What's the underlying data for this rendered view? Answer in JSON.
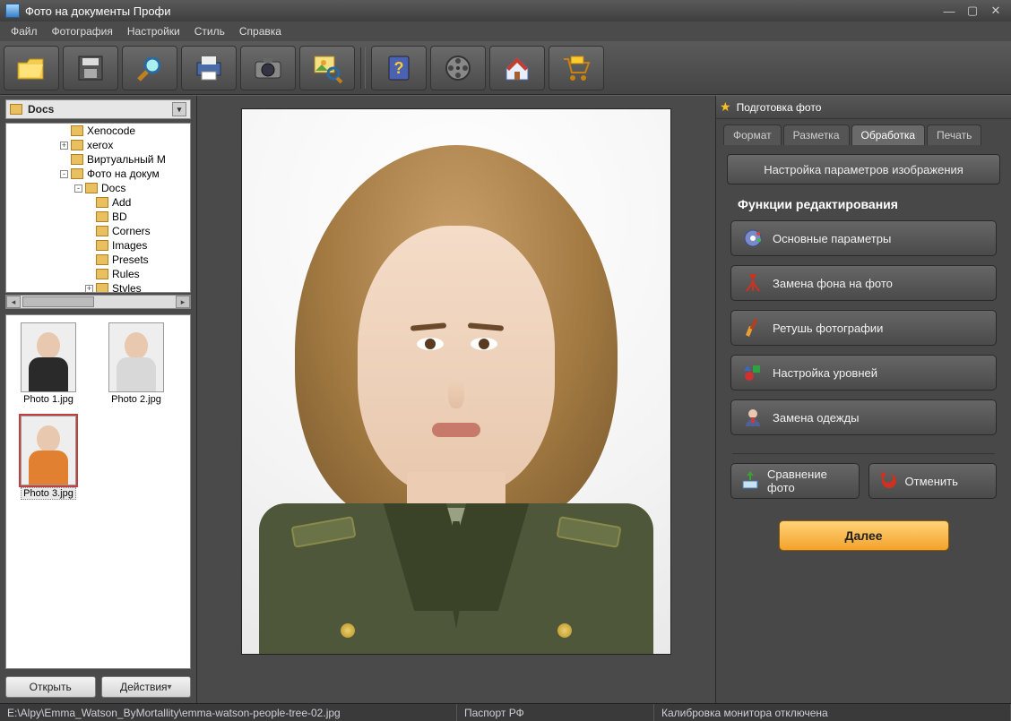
{
  "title": "Фото на документы Профи",
  "menubar": [
    "Файл",
    "Фотография",
    "Настройки",
    "Стиль",
    "Справка"
  ],
  "toolbar_icons": [
    "open-folder-icon",
    "save-icon",
    "search-magnifier-icon",
    "print-icon",
    "camera-icon",
    "image-magnifier-icon",
    "help-book-icon",
    "film-reel-icon",
    "home-icon",
    "shopping-cart-icon"
  ],
  "path_select": "Docs",
  "tree": [
    {
      "pad": 68,
      "exp": "",
      "label": "Xenocode"
    },
    {
      "pad": 56,
      "exp": "+",
      "label": "xerox"
    },
    {
      "pad": 68,
      "exp": "",
      "label": "Виртуальный М"
    },
    {
      "pad": 56,
      "exp": "-",
      "label": "Фото на докум"
    },
    {
      "pad": 72,
      "exp": "-",
      "label": "Docs"
    },
    {
      "pad": 96,
      "exp": "",
      "label": "Add"
    },
    {
      "pad": 96,
      "exp": "",
      "label": "BD"
    },
    {
      "pad": 96,
      "exp": "",
      "label": "Corners"
    },
    {
      "pad": 96,
      "exp": "",
      "label": "Images"
    },
    {
      "pad": 96,
      "exp": "",
      "label": "Presets"
    },
    {
      "pad": 96,
      "exp": "",
      "label": "Rules"
    },
    {
      "pad": 84,
      "exp": "+",
      "label": "Styles"
    }
  ],
  "thumbs": [
    {
      "name": "Photo 1.jpg",
      "selected": false,
      "body": "#2a2a2a"
    },
    {
      "name": "Photo 2.jpg",
      "selected": false,
      "body": "#d8d8d8"
    },
    {
      "name": "Photo 3.jpg",
      "selected": true,
      "body": "#e08030"
    }
  ],
  "left_buttons": {
    "open": "Открыть",
    "actions": "Действия"
  },
  "right": {
    "header": "Подготовка фото",
    "tabs": [
      "Формат",
      "Разметка",
      "Обработка",
      "Печать"
    ],
    "active_tab": 2,
    "big_button": "Настройка параметров изображения",
    "section_title": "Функции редактирования",
    "functions": [
      {
        "icon": "gear-icon",
        "label": "Основные параметры"
      },
      {
        "icon": "tripod-icon",
        "label": "Замена фона на фото"
      },
      {
        "icon": "brush-icon",
        "label": "Ретушь фотографии"
      },
      {
        "icon": "levels-icon",
        "label": "Настройка уровней"
      },
      {
        "icon": "clothes-icon",
        "label": "Замена одежды"
      }
    ],
    "compare": "Сравнение фото",
    "undo": "Отменить",
    "next": "Далее"
  },
  "status": {
    "path": "E:\\Alpy\\Emma_Watson_ByMortallity\\emma-watson-people-tree-02.jpg",
    "format": "Паспорт РФ",
    "calibration": "Калибровка монитора отключена"
  }
}
